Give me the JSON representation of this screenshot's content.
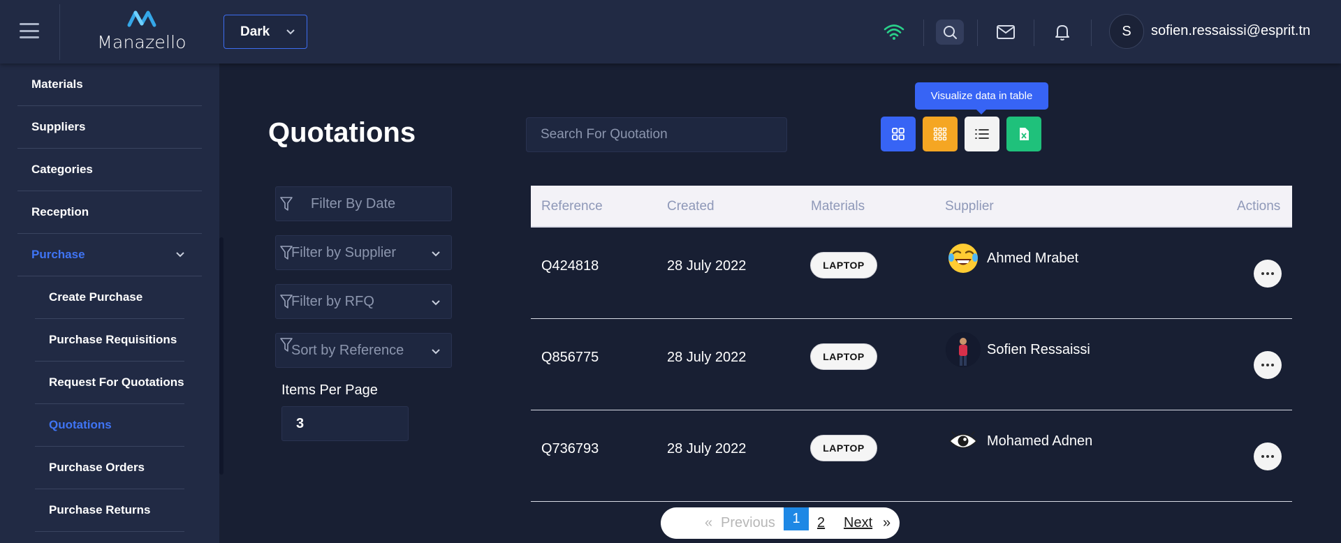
{
  "header": {
    "logo_text": "Manazello",
    "theme_value": "Dark",
    "user_initial": "S",
    "user_email": "sofien.ressaissi@esprit.tn",
    "icons": [
      "menu-icon",
      "wifi-icon",
      "search-icon",
      "mail-icon",
      "bell-icon",
      "chevron-down-icon"
    ]
  },
  "sidebar": {
    "items": [
      {
        "label": "Materials"
      },
      {
        "label": "Suppliers"
      },
      {
        "label": "Categories"
      },
      {
        "label": "Reception"
      },
      {
        "label": "Purchase",
        "active": true,
        "expanded": true
      }
    ],
    "sub_items": [
      {
        "label": "Create Purchase"
      },
      {
        "label": "Purchase Requisitions"
      },
      {
        "label": "Request For Quotations"
      },
      {
        "label": "Quotations",
        "active": true
      },
      {
        "label": "Purchase Orders"
      },
      {
        "label": "Purchase Returns"
      }
    ]
  },
  "main": {
    "title": "Quotations",
    "search_placeholder": "Search For Quotation",
    "tooltip": "Visualize data in table",
    "view_buttons": [
      {
        "name": "grid-view-icon",
        "color": "#3764f5"
      },
      {
        "name": "dense-grid-view-icon",
        "color": "#f5a623"
      },
      {
        "name": "list-view-icon",
        "color": "#f3f3f3"
      },
      {
        "name": "excel-export-icon",
        "color": "#1fc17b"
      }
    ],
    "filters": {
      "date_placeholder": "Filter By Date",
      "supplier": "Filter by Supplier",
      "rfq": "Filter by RFQ",
      "sort": "Sort by Reference"
    },
    "items_per_page_label": "Items Per Page",
    "items_per_page_value": "3"
  },
  "table": {
    "columns": [
      "Reference",
      "Created",
      "Materials",
      "Supplier",
      "Actions"
    ],
    "rows": [
      {
        "reference": "Q424818",
        "created": "28 July 2022",
        "material": "LAPTOP",
        "supplier": "Ahmed Mrabet",
        "avatar": "laughing-emoji-icon"
      },
      {
        "reference": "Q856775",
        "created": "28 July 2022",
        "material": "LAPTOP",
        "supplier": "Sofien Ressaissi",
        "avatar": "person-photo-avatar"
      },
      {
        "reference": "Q736793",
        "created": "28 July 2022",
        "material": "LAPTOP",
        "supplier": "Mohamed Adnen",
        "avatar": "eye-emoji-icon"
      }
    ]
  },
  "pagination": {
    "first": "«",
    "previous": "Previous",
    "pages": [
      "1",
      "2"
    ],
    "current_page": "1",
    "next": "Next",
    "last": "»"
  }
}
